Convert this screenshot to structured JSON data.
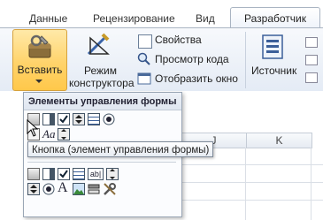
{
  "tabs": [
    {
      "label": "Данные"
    },
    {
      "label": "Рецензирование"
    },
    {
      "label": "Вид"
    },
    {
      "label": "Разработчик"
    }
  ],
  "ribbon": {
    "insert_label": "Вставить",
    "design_mode_label_1": "Режим",
    "design_mode_label_2": "конструктора",
    "properties_label": "Свойства",
    "view_code_label": "Просмотр кода",
    "show_window_label": "Отобразить окно",
    "source_label": "Источник"
  },
  "sheet": {
    "columns": [
      "J",
      "K"
    ]
  },
  "popup": {
    "title": "Элементы управления формы",
    "tooltip": "Кнопка (элемент управления формы)",
    "form_icons_row1": [
      "button-icon",
      "combo-box-icon",
      "check-box-icon",
      "spin-button-icon",
      "list-box-icon",
      "option-button-icon"
    ],
    "form_icons_row2": [
      "group-box-icon",
      "label-icon",
      "scroll-bar-icon"
    ],
    "activex_icons_row1": [
      "command-button-icon",
      "combo-box-icon",
      "check-box-icon",
      "list-box-icon",
      "text-box-icon",
      "scroll-bar-icon"
    ],
    "activex_icons_row2": [
      "spin-button-icon",
      "option-button-icon",
      "label-icon",
      "image-icon",
      "toggle-button-icon",
      "more-controls-icon"
    ]
  },
  "colors": {
    "accent": "#ffd36b",
    "ribbon": "#e4ebf5"
  }
}
